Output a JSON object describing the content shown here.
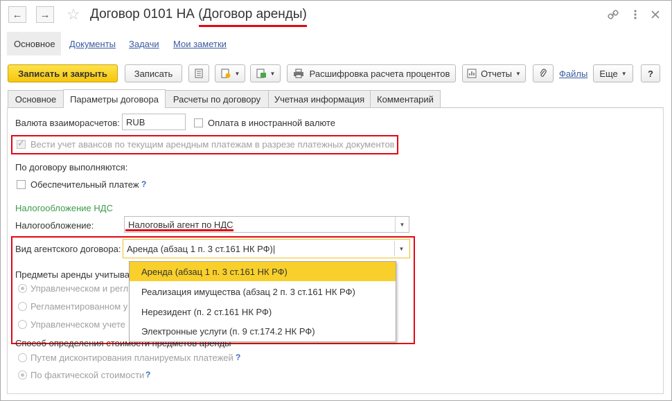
{
  "window": {
    "title_main": "Договор 0101 НА",
    "title_sub": "(Договор аренды)",
    "nav_back": "←",
    "nav_forward": "→",
    "star": "☆"
  },
  "sections": {
    "active": "Основное",
    "links": [
      "Документы",
      "Задачи",
      "Мои заметки"
    ]
  },
  "toolbar": {
    "save_close": "Записать и закрыть",
    "save": "Записать",
    "decode": "Расшифровка расчета процентов",
    "reports": "Отчеты",
    "files": "Файлы",
    "more": "Еще",
    "help": "?"
  },
  "tabs": [
    "Основное",
    "Параметры договора",
    "Расчеты по договору",
    "Учетная информация",
    "Комментарий"
  ],
  "form": {
    "currency_label": "Валюта взаиморасчетов:",
    "currency_value": "RUB",
    "foreign_payment_label": "Оплата в иностранной валюте",
    "advance_label": "Вести учет авансов по текущим арендным платежам в разрезе платежных документов",
    "performed_label": "По договору выполняются:",
    "security_payment_label": "Обеспечительный платеж",
    "vat_section": "Налогообложение НДС",
    "taxation_label": "Налогообложение:",
    "taxation_value": "Налоговый агент по НДС",
    "agent_contract_label": "Вид агентского договора:",
    "agent_contract_value": "Аренда (абзац 1 п. 3 ст.161 НК РФ)",
    "rent_items_label": "Предметы аренды учитыва",
    "rent_opt1": "Управленческом и регл",
    "rent_opt2": "Регламентированном у",
    "rent_opt3": "Управленческом учете",
    "cost_method_label": "Способ определения стоимости предметов аренды",
    "cost_opt1": "Путем дисконтирования планируемых платежей",
    "cost_opt2": "По фактической стоимости",
    "q": "?"
  },
  "dropdown": {
    "items": [
      "Аренда (абзац 1 п. 3 ст.161 НК РФ)",
      "Реализация имущества (абзац 2 п. 3 ст.161 НК РФ)",
      "Нерезидент (п. 2 ст.161 НК РФ)",
      "Электронные услуги (п. 9 ст.174.2 НК РФ)"
    ],
    "selected_index": 0
  },
  "colors": {
    "highlight_red": "#e30613",
    "primary_yellow": "#f6c60e",
    "selected_item": "#f9d02b",
    "link_blue": "#3a5ba0",
    "section_green": "#3c9a4d"
  }
}
